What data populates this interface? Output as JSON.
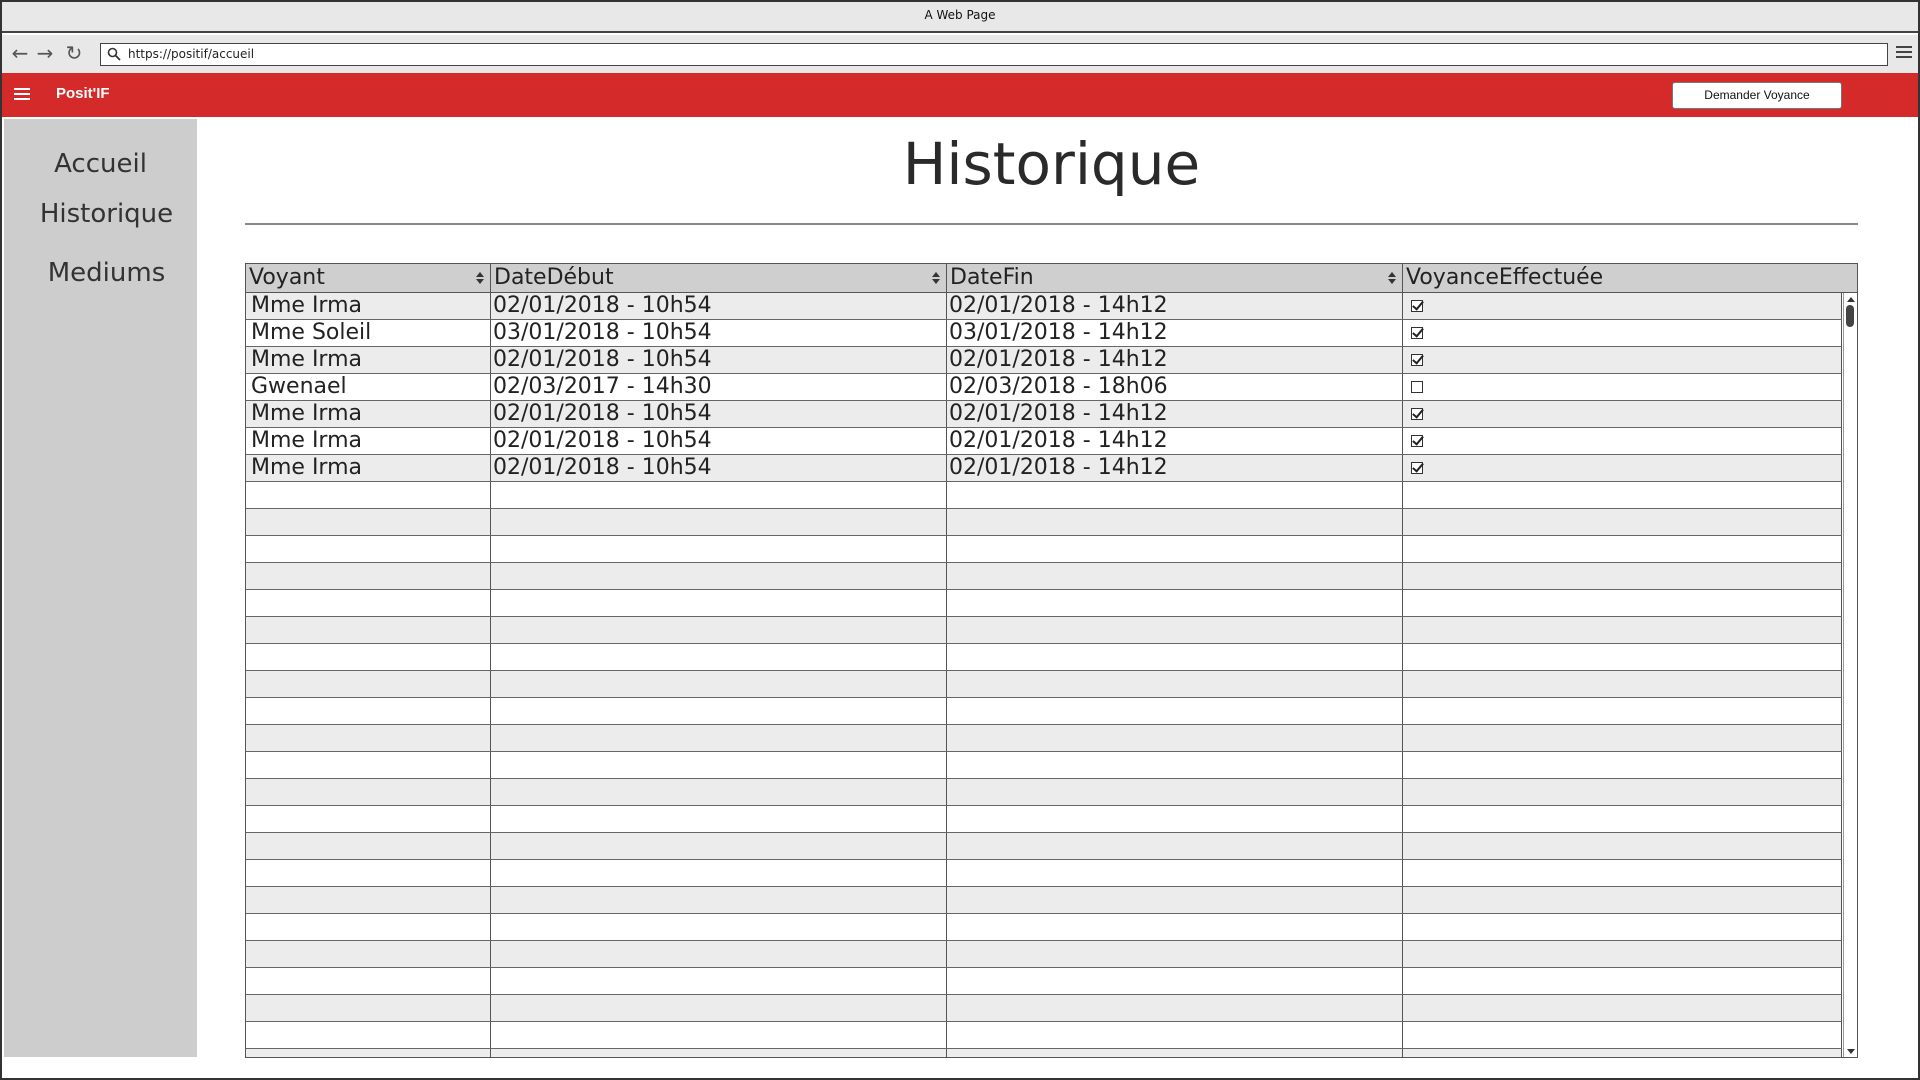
{
  "window": {
    "title": "A Web Page"
  },
  "browser": {
    "url": "https://positif/accueil",
    "icons": [
      "back-arrow-icon",
      "forward-arrow-icon",
      "reload-icon",
      "search-icon",
      "menu-icon"
    ]
  },
  "appbar": {
    "brand": "Posit'IF",
    "request_button": "Demander Voyance",
    "accent_color": "#d42a2a"
  },
  "sidebar": {
    "items": [
      {
        "label": "Accueil"
      },
      {
        "label": "Historique"
      },
      {
        "label": "Mediums"
      }
    ]
  },
  "main": {
    "title": "Historique",
    "table": {
      "columns": [
        "Voyant",
        "DateDébut",
        "DateFin",
        "VoyanceEffectuée"
      ],
      "rows": [
        {
          "voyant": "Mme Irma",
          "debut": "02/01/2018 - 10h54",
          "fin": "02/01/2018 - 14h12",
          "effectuee": true
        },
        {
          "voyant": "Mme Soleil",
          "debut": "03/01/2018 - 10h54",
          "fin": "03/01/2018 - 14h12",
          "effectuee": true
        },
        {
          "voyant": "Mme Irma",
          "debut": "02/01/2018 - 10h54",
          "fin": "02/01/2018 - 14h12",
          "effectuee": true
        },
        {
          "voyant": "Gwenael",
          "debut": "02/03/2017 - 14h30",
          "fin": "02/03/2018 - 18h06",
          "effectuee": false
        },
        {
          "voyant": "Mme Irma",
          "debut": "02/01/2018 - 10h54",
          "fin": "02/01/2018 - 14h12",
          "effectuee": true
        },
        {
          "voyant": "Mme Irma",
          "debut": "02/01/2018 - 10h54",
          "fin": "02/01/2018 - 14h12",
          "effectuee": true
        },
        {
          "voyant": "Mme Irma",
          "debut": "02/01/2018 - 10h54",
          "fin": "02/01/2018 - 14h12",
          "effectuee": true
        }
      ]
    }
  }
}
